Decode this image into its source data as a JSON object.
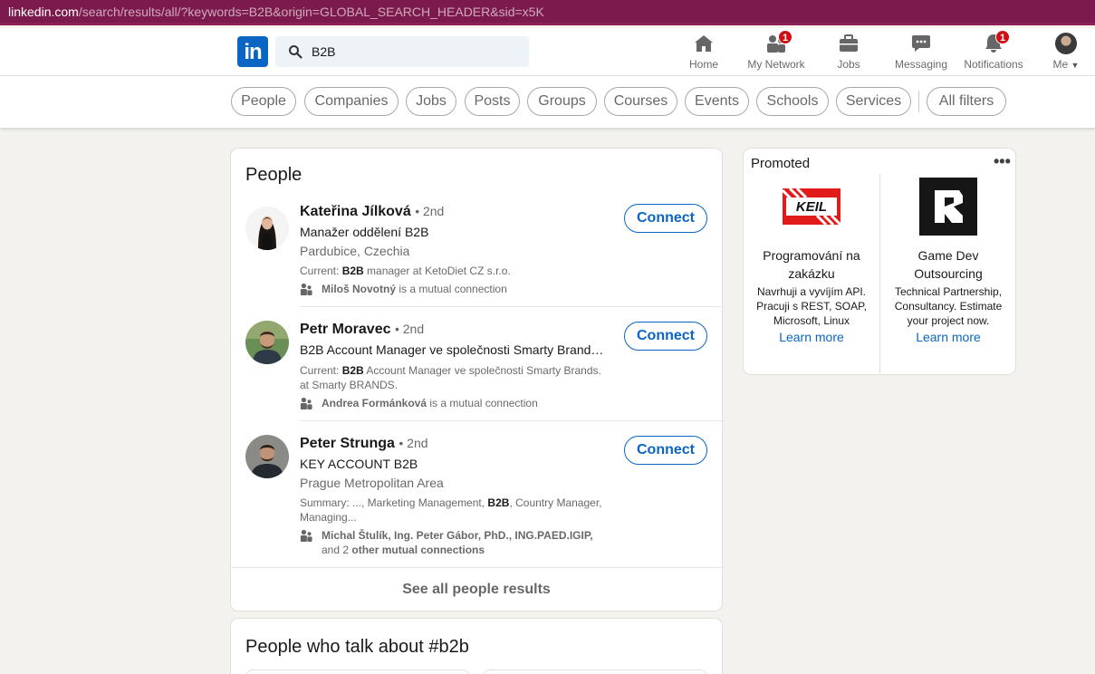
{
  "browser": {
    "url_host": "linkedin.com",
    "url_path": "/search/results/all/?keywords=B2B&origin=GLOBAL_SEARCH_HEADER&sid=x5K"
  },
  "nav": {
    "logo_text": "in",
    "search_value": "B2B",
    "items": [
      {
        "label": "Home",
        "icon": "home-icon",
        "badge": ""
      },
      {
        "label": "My Network",
        "icon": "network-icon",
        "badge": "1"
      },
      {
        "label": "Jobs",
        "icon": "briefcase-icon",
        "badge": ""
      },
      {
        "label": "Messaging",
        "icon": "message-icon",
        "badge": ""
      },
      {
        "label": "Notifications",
        "icon": "bell-icon",
        "badge": "1"
      },
      {
        "label": "Me",
        "icon": "avatar",
        "badge": ""
      }
    ]
  },
  "filters": [
    "People",
    "Companies",
    "Jobs",
    "Posts",
    "Groups",
    "Courses",
    "Events",
    "Schools",
    "Services"
  ],
  "all_filters": "All filters",
  "people": {
    "title": "People",
    "results": [
      {
        "name": "Kateřina Jílková",
        "degree": "• 2nd",
        "headline": "Manažer oddělení B2B",
        "location": "Pardubice, Czechia",
        "summary_prefix": "Current: ",
        "summary_bold": "B2B",
        "summary_rest": " manager at KetoDiet CZ s.r.o.",
        "mutual_bold": "Miloš Novotný",
        "mutual_rest": " is a mutual connection",
        "connect": "Connect"
      },
      {
        "name": "Petr Moravec",
        "degree": "• 2nd",
        "headline": "B2B Account Manager ve společnosti Smarty Brands....",
        "location": "",
        "summary_prefix": "Current: ",
        "summary_bold": "B2B",
        "summary_rest": " Account Manager ve společnosti Smarty Brands. at Smarty BRANDS.",
        "mutual_bold": "Andrea Formánková",
        "mutual_rest": " is a mutual connection",
        "connect": "Connect"
      },
      {
        "name": "Peter Strunga",
        "degree": "• 2nd",
        "headline": "KEY ACCOUNT B2B",
        "location": "Prague Metropolitan Area",
        "summary_prefix": "Summary: ..., Marketing Management, ",
        "summary_bold": "B2B",
        "summary_rest": ", Country Manager, Managing...",
        "mutual_bold": "Michal Štulík, Ing. Peter Gábor, PhD., ING.PAED.IGIP,",
        "mutual_rest": " and 2 ",
        "mutual_bold2": "other mutual connections",
        "connect": "Connect"
      }
    ],
    "see_all": "See all people results"
  },
  "talk": {
    "title": "People who talk about #b2b"
  },
  "promoted": {
    "title": "Promoted",
    "menu": "•••",
    "ads": [
      {
        "logo_text": "KEIL",
        "headline": "Programování na zakázku",
        "description": "Navrhuji a vyvíjím API. Pracuji s REST, SOAP, Microsoft, Linux",
        "link": "Learn more"
      },
      {
        "logo_text": "",
        "headline": "Game Dev Outsourcing",
        "description": "Technical Partnership, Consultancy. Estimate your project now.",
        "link": "Learn more"
      }
    ]
  }
}
